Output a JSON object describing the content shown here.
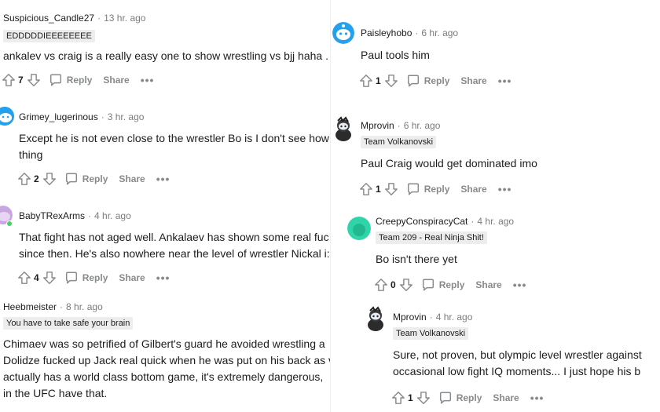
{
  "colors": {
    "icon_gray": "#878a8c",
    "flair_bg": "#ededed",
    "meta_gray": "#7c7c7c",
    "online_green": "#46d160"
  },
  "left": {
    "c1": {
      "user": "Suspicious_Candle27",
      "time": "13 hr. ago",
      "flair": "EDDDDDIEEEEEEEE",
      "body": "ankalev vs craig is a really easy one to show wrestling vs bjj haha .",
      "votes": "7",
      "reply": "Reply",
      "share": "Share",
      "more": "•••"
    },
    "c2": {
      "user": "Grimey_lugerinous",
      "time": "3 hr. ago",
      "body1": "Except he is not even close to the wrestler Bo is I don't see how",
      "body2": "thing",
      "votes": "2",
      "reply": "Reply",
      "share": "Share",
      "more": "•••"
    },
    "c3": {
      "user": "BabyTRexArms",
      "time": "4 hr. ago",
      "body1": "That fight has not aged well. Ankalaev has shown some real fuc",
      "body2": "since then. He's also nowhere near the level of wrestler Nickal i:",
      "votes": "4",
      "reply": "Reply",
      "share": "Share",
      "more": "•••"
    },
    "c4": {
      "user": "Heebmeister",
      "time": "8 hr. ago",
      "flair": "You have to take safe your brain",
      "body1": "Chimaev was so petrified of Gilbert's guard he avoided wrestling a",
      "body2": "Dolidze fucked up Jack real quick when he was put on his back as v",
      "body3": "actually has a world class bottom game, it's extremely dangerous,",
      "body4": "in the UFC have that."
    }
  },
  "right": {
    "c1": {
      "user": "Paisleyhobo",
      "time": "6 hr. ago",
      "body": "Paul tools him",
      "votes": "1",
      "reply": "Reply",
      "share": "Share",
      "more": "•••"
    },
    "c2": {
      "user": "Mprovin",
      "time": "6 hr. ago",
      "flair": "Team Volkanovski",
      "body": "Paul Craig would get dominated imo",
      "votes": "1",
      "reply": "Reply",
      "share": "Share",
      "more": "•••"
    },
    "c3": {
      "user": "CreepyConspiracyCat",
      "time": "4 hr. ago",
      "flair": "Team 209 - Real Ninja Shit!",
      "body": "Bo isn't there yet",
      "votes": "0",
      "reply": "Reply",
      "share": "Share",
      "more": "•••"
    },
    "c4": {
      "user": "Mprovin",
      "time": "4 hr. ago",
      "flair": "Team Volkanovski",
      "body1": "Sure, not proven, but olympic level wrestler against",
      "body2": "occasional low fight IQ moments... I just hope his b",
      "votes": "1",
      "reply": "Reply",
      "share": "Share",
      "more": "•••"
    }
  }
}
